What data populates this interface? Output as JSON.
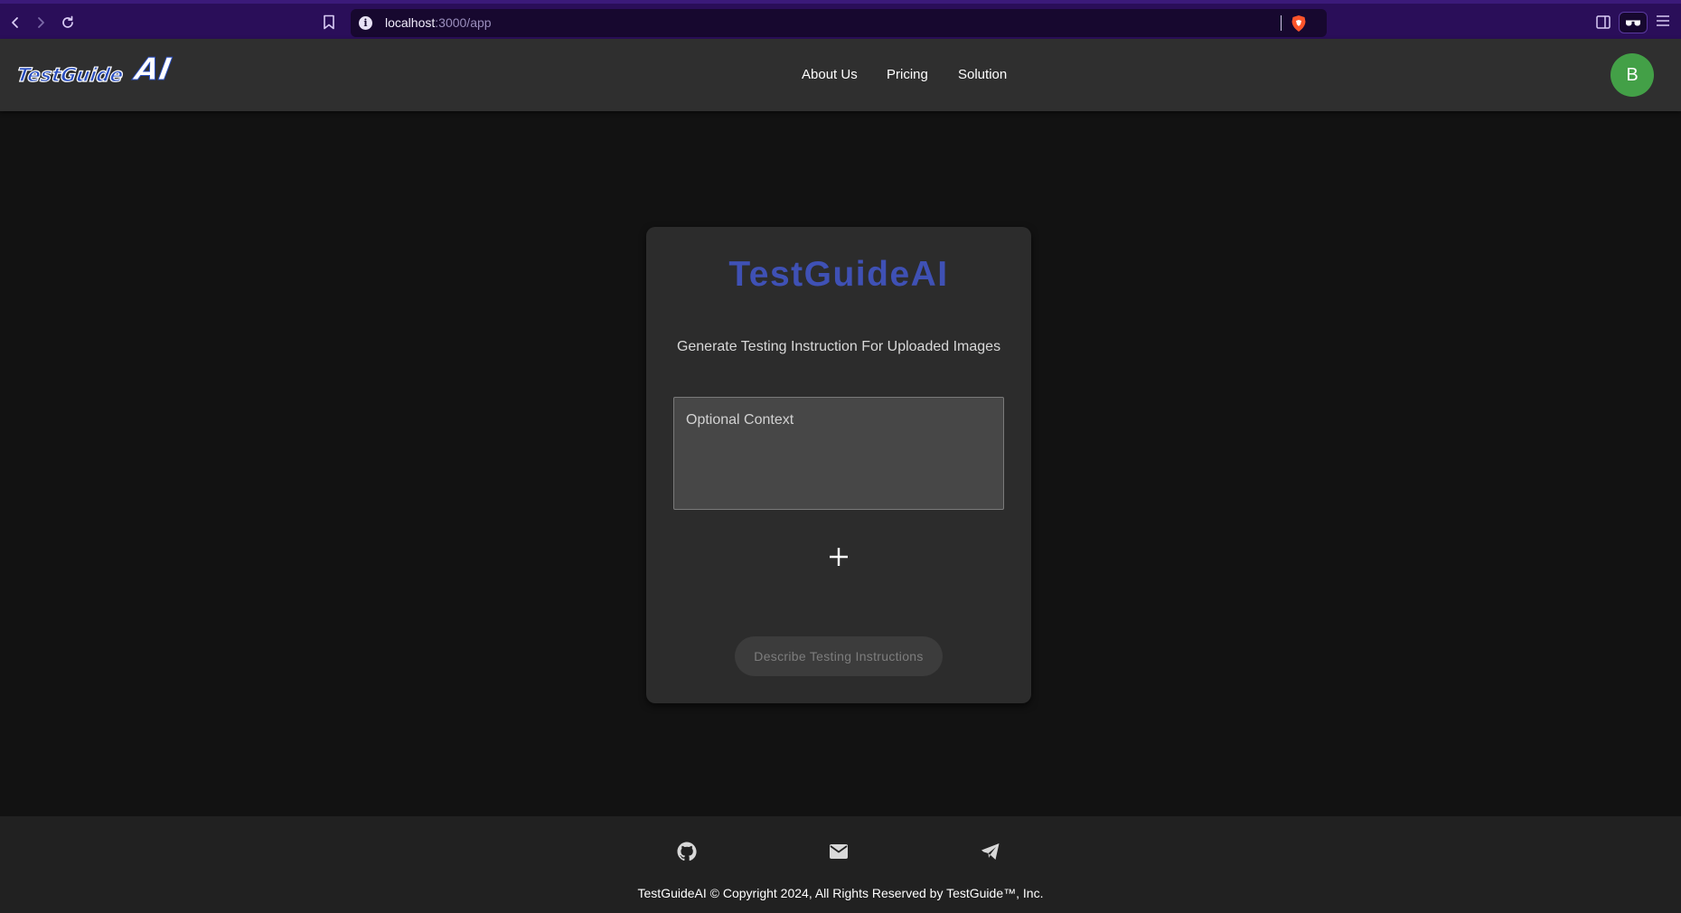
{
  "browser": {
    "url_host": "localhost",
    "url_rest": ":3000/app",
    "back_icon": "chevron-left-icon",
    "forward_icon": "chevron-right-icon",
    "reload_icon": "reload-icon",
    "bookmark_icon": "bookmark-icon",
    "info_icon": "info-icon",
    "brave_shield_icon": "brave-shield-icon",
    "sidebar_icon": "sidebar-icon",
    "extension_icon": "glasses-icon",
    "menu_icon": "hamburger-menu-icon"
  },
  "header": {
    "logo_small": "TestGuide",
    "logo_big": "AI",
    "nav": [
      {
        "label": "About Us"
      },
      {
        "label": "Pricing"
      },
      {
        "label": "Solution"
      }
    ],
    "avatar_initial": "B",
    "avatar_color": "#43a047"
  },
  "card": {
    "title": "TestGuideAI",
    "title_color": "#3f51b5",
    "subtitle": "Generate Testing Instruction For Uploaded Images",
    "context_placeholder": "Optional Context",
    "context_value": "",
    "add_icon": "plus-icon",
    "describe_button": "Describe Testing Instructions"
  },
  "footer": {
    "icons": [
      "github-icon",
      "email-icon",
      "telegram-icon"
    ],
    "copyright": "TestGuideAI © Copyright 2024, All Rights Reserved by TestGuide™, Inc."
  }
}
